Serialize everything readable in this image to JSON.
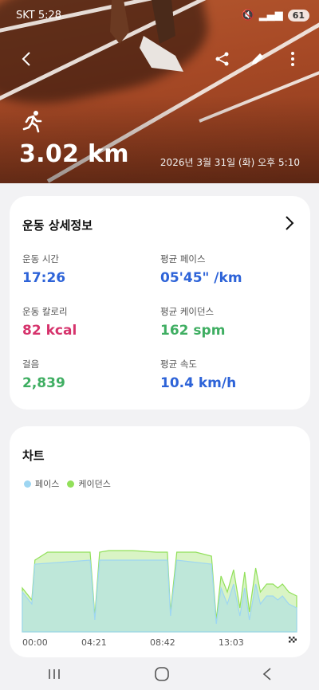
{
  "status_bar": {
    "carrier_time": "SKT 5:28",
    "battery": "61"
  },
  "hero": {
    "distance": "3.02 km",
    "datetime": "2026년 3월 31일 (화) 오후 5:10"
  },
  "details": {
    "title": "운동 상세정보",
    "metrics": [
      {
        "label": "운동 시간",
        "number": "17:26",
        "unit": "",
        "color": "#2d63d8"
      },
      {
        "label": "평균 페이스",
        "number": "05'45\"",
        "unit": " /km",
        "color": "#2d63d8"
      },
      {
        "label": "운동 칼로리",
        "number": "82",
        "unit": " kcal",
        "color": "#d6336c"
      },
      {
        "label": "평균 케이던스",
        "number": "162",
        "unit": " spm",
        "color": "#3fae62"
      },
      {
        "label": "걸음",
        "number": "2,839",
        "unit": "",
        "color": "#3fae62"
      },
      {
        "label": "평균 속도",
        "number": "10.4",
        "unit": " km/h",
        "color": "#2d63d8"
      }
    ]
  },
  "chart": {
    "title": "차트",
    "legend": [
      {
        "name": "페이스",
        "color": "#9ed6f2"
      },
      {
        "name": "케이던스",
        "color": "#92e05a"
      }
    ]
  },
  "chart_data": {
    "type": "area",
    "x_tick_labels": [
      "00:00",
      "04:21",
      "08:42",
      "13:03"
    ],
    "x_range_min": [
      0,
      17.4
    ],
    "series": [
      {
        "name": "케이던스",
        "color": "#92e05a",
        "x": [
          0,
          0.6,
          0.8,
          1.6,
          3,
          4.3,
          4.6,
          4.9,
          5.5,
          7,
          8.5,
          9.2,
          9.4,
          9.8,
          11,
          12,
          12.3,
          12.6,
          13.0,
          13.4,
          13.8,
          14.1,
          14.4,
          14.8,
          15.1,
          15.5,
          15.9,
          16.2,
          16.5,
          16.9,
          17.4
        ],
        "values": [
          0.55,
          0.4,
          0.9,
          1.0,
          1.0,
          1.0,
          0.2,
          1.0,
          1.02,
          1.02,
          1.0,
          1.0,
          0.25,
          1.0,
          1.0,
          0.95,
          0.15,
          0.7,
          0.5,
          0.78,
          0.3,
          0.75,
          0.25,
          0.8,
          0.5,
          0.6,
          0.6,
          0.55,
          0.6,
          0.5,
          0.45
        ]
      },
      {
        "name": "페이스",
        "color": "#9ed6f2",
        "x": [
          0,
          0.6,
          0.8,
          4.3,
          4.6,
          4.9,
          9.2,
          9.4,
          9.8,
          12.0,
          12.3,
          12.6,
          13.0,
          13.4,
          13.8,
          14.1,
          14.4,
          14.8,
          15.1,
          15.5,
          15.9,
          16.2,
          16.5,
          16.9,
          17.4
        ],
        "values": [
          0.5,
          0.35,
          0.85,
          0.9,
          0.15,
          0.9,
          0.9,
          0.2,
          0.9,
          0.85,
          0.1,
          0.55,
          0.35,
          0.6,
          0.2,
          0.55,
          0.15,
          0.6,
          0.35,
          0.45,
          0.45,
          0.4,
          0.45,
          0.35,
          0.3
        ]
      }
    ]
  }
}
